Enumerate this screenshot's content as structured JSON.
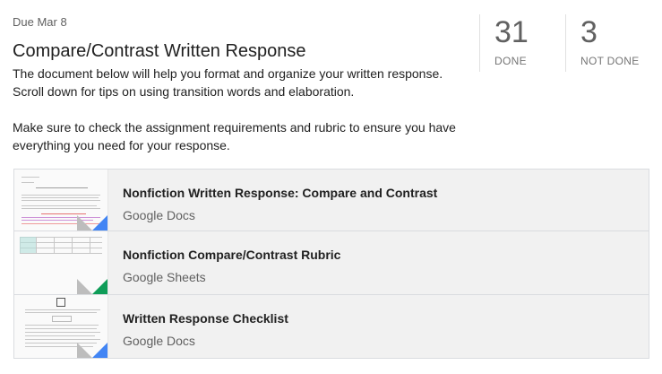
{
  "assignment": {
    "due": "Due Mar 8",
    "title": "Compare/Contrast Written Response",
    "description": [
      "The document below will help you format and organize your written response. Scroll down for tips on using transition words and elaboration.",
      "Make sure to check the assignment requirements and rubric to ensure you have everything you need for your response."
    ]
  },
  "stats": {
    "done_count": "31",
    "done_label": "DONE",
    "not_done_count": "3",
    "not_done_label": "NOT DONE"
  },
  "attachments": [
    {
      "name": "Nonfiction Written Response: Compare and Contrast",
      "type": "Google Docs",
      "accent": "#4285f4",
      "icon": "docs-thumbnail"
    },
    {
      "name": "Nonfiction Compare/Contrast Rubric",
      "type": "Google Sheets",
      "accent": "#0f9d58",
      "icon": "sheets-thumbnail"
    },
    {
      "name": "Written Response Checklist",
      "type": "Google Docs",
      "accent": "#4285f4",
      "icon": "docs-thumbnail"
    }
  ]
}
